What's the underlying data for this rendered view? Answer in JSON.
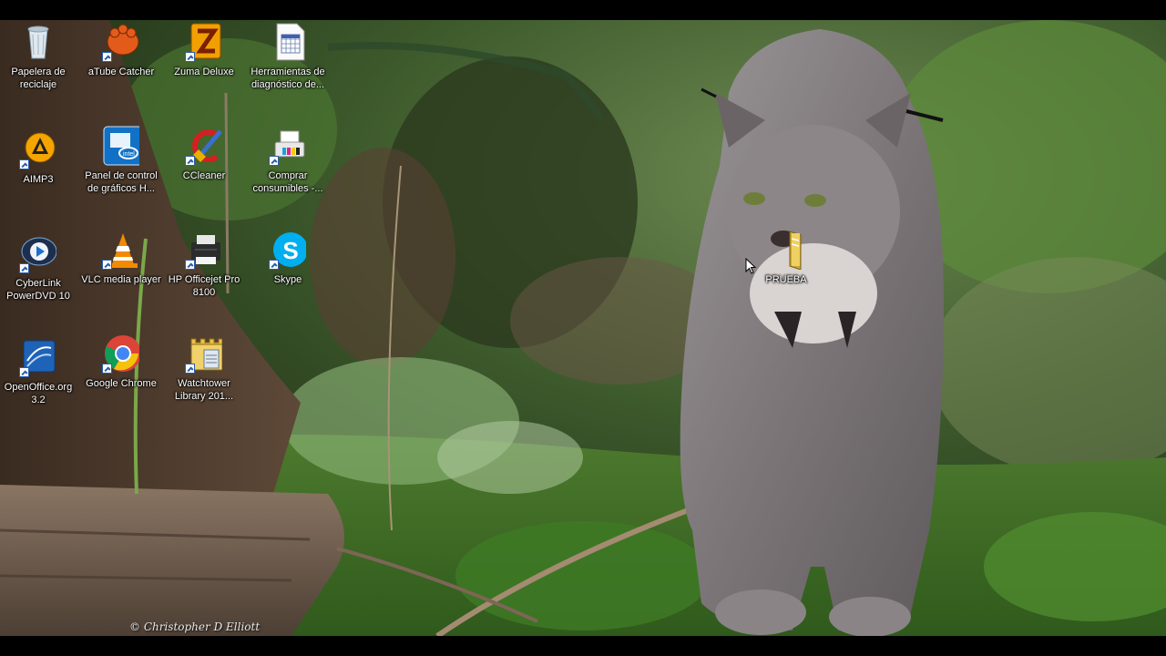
{
  "desktop": {
    "icons": [
      {
        "name": "recycle-bin-icon",
        "label": "Papelera de reciclaje"
      },
      {
        "name": "atube-catcher-icon",
        "label": "aTube Catcher"
      },
      {
        "name": "zuma-deluxe-icon",
        "label": "Zuma Deluxe"
      },
      {
        "name": "diagnostic-tools-icon",
        "label": "Herramientas de diagnóstico de..."
      },
      {
        "name": "aimp3-icon",
        "label": "AIMP3"
      },
      {
        "name": "intel-graphics-icon",
        "label": "Panel de control de gráficos H..."
      },
      {
        "name": "ccleaner-icon",
        "label": "CCleaner"
      },
      {
        "name": "buy-supplies-icon",
        "label": "Comprar consumibles -..."
      },
      {
        "name": "powerdvd-icon",
        "label": "CyberLink PowerDVD 10"
      },
      {
        "name": "vlc-icon",
        "label": "VLC media player"
      },
      {
        "name": "printer-icon",
        "label": "HP Officejet Pro 8100"
      },
      {
        "name": "skype-icon",
        "label": "Skype"
      },
      {
        "name": "openoffice-icon",
        "label": "OpenOffice.org 3.2"
      },
      {
        "name": "chrome-icon",
        "label": "Google Chrome"
      },
      {
        "name": "watchtower-icon",
        "label": "Watchtower Library 201..."
      },
      {
        "name": "folder-icon",
        "label": "PRUEBA"
      }
    ],
    "watermark": "© Christopher D Elliott"
  },
  "colors": {
    "letterbox": "#000000",
    "label_text": "#ffffff"
  }
}
